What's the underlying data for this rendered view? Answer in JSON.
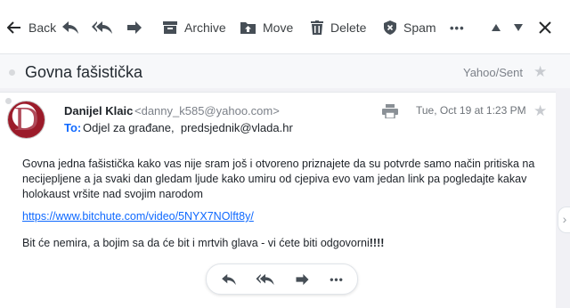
{
  "toolbar": {
    "back_label": "Back",
    "archive_label": "Archive",
    "move_label": "Move",
    "delete_label": "Delete",
    "spam_label": "Spam",
    "more_label": "•••"
  },
  "message": {
    "subject": "Govna fašistička",
    "folder": "Yahoo/Sent",
    "avatar_letter": "D",
    "from_name": "Danijel Klaic",
    "from_email": "<danny_k585@yahoo.com>",
    "to_label": "To:",
    "to_value": "Odjel za građane,  predsjednik@vlada.hr",
    "date": "Tue, Oct 19 at 1:23 PM",
    "body": "Govna jedna fašistička kako vas nije sram još i otvoreno priznajete da su potvrde samo način pritiska na necijepljene a ja svaki dan gledam ljude kako umiru od cjepiva evo vam jedan link pa pogledajte kakav holokaust vršite nad svojim narodom",
    "link": "https://www.bitchute.com/video/5NYX7NOlft8y/",
    "closing": "Bit će nemira, a bojim sa da će bit i mrtvih glava - vi ćete biti odgovorni",
    "closing_emphasis": "!!!!"
  },
  "colors": {
    "accent": "#0f69ff",
    "icon": "#464e56",
    "background": "#f1f1f5"
  },
  "icons": [
    "back-arrow-icon",
    "reply-icon",
    "reply-all-icon",
    "forward-icon",
    "archive-icon",
    "move-icon",
    "delete-icon",
    "spam-shield-icon",
    "more-icon",
    "previous-icon",
    "next-icon",
    "close-icon",
    "star-icon",
    "print-icon",
    "chevron-right-icon"
  ]
}
